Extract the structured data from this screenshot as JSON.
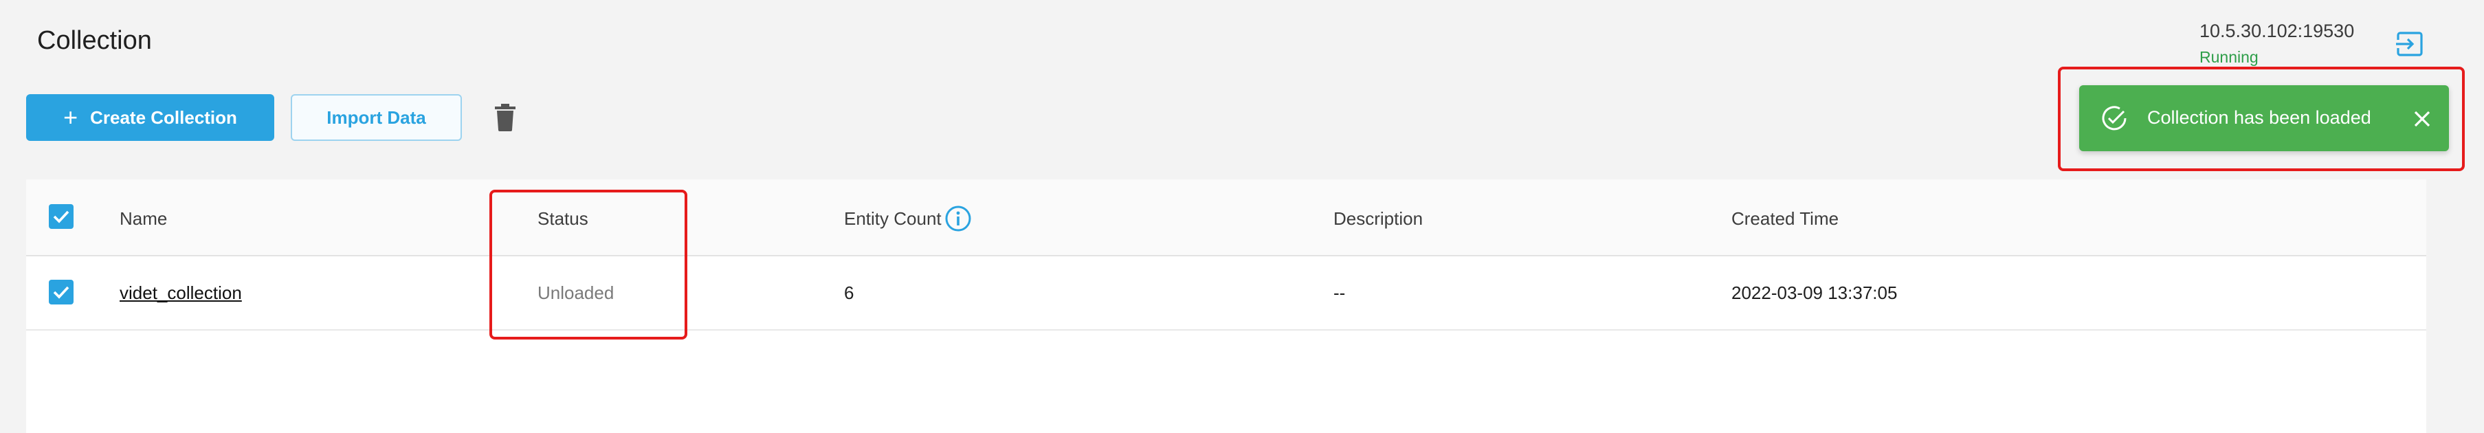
{
  "header": {
    "title": "Collection",
    "connection_address": "10.5.30.102:19530",
    "connection_status": "Running",
    "status_color": "#2e9e49",
    "logout_icon": "logout-icon"
  },
  "toolbar": {
    "create_label": "Create Collection",
    "create_icon": "plus-icon",
    "import_label": "Import Data",
    "delete_icon": "trash-icon"
  },
  "table": {
    "columns": [
      "Name",
      "Status",
      "Entity Count",
      "Description",
      "Created Time"
    ],
    "info_icon": "info-icon",
    "rows": [
      {
        "selected": true,
        "name": "videt_collection",
        "status": "Unloaded",
        "entity_count": "6",
        "description": "--",
        "created_time": "2022-03-09 13:37:05"
      }
    ]
  },
  "toast": {
    "message": "Collection has been loaded",
    "check_icon": "check-circle-icon",
    "close_icon": "close-icon",
    "color": "#4caf50"
  },
  "colors": {
    "accent": "#2aa3e0",
    "highlight": "#e61b1b"
  }
}
